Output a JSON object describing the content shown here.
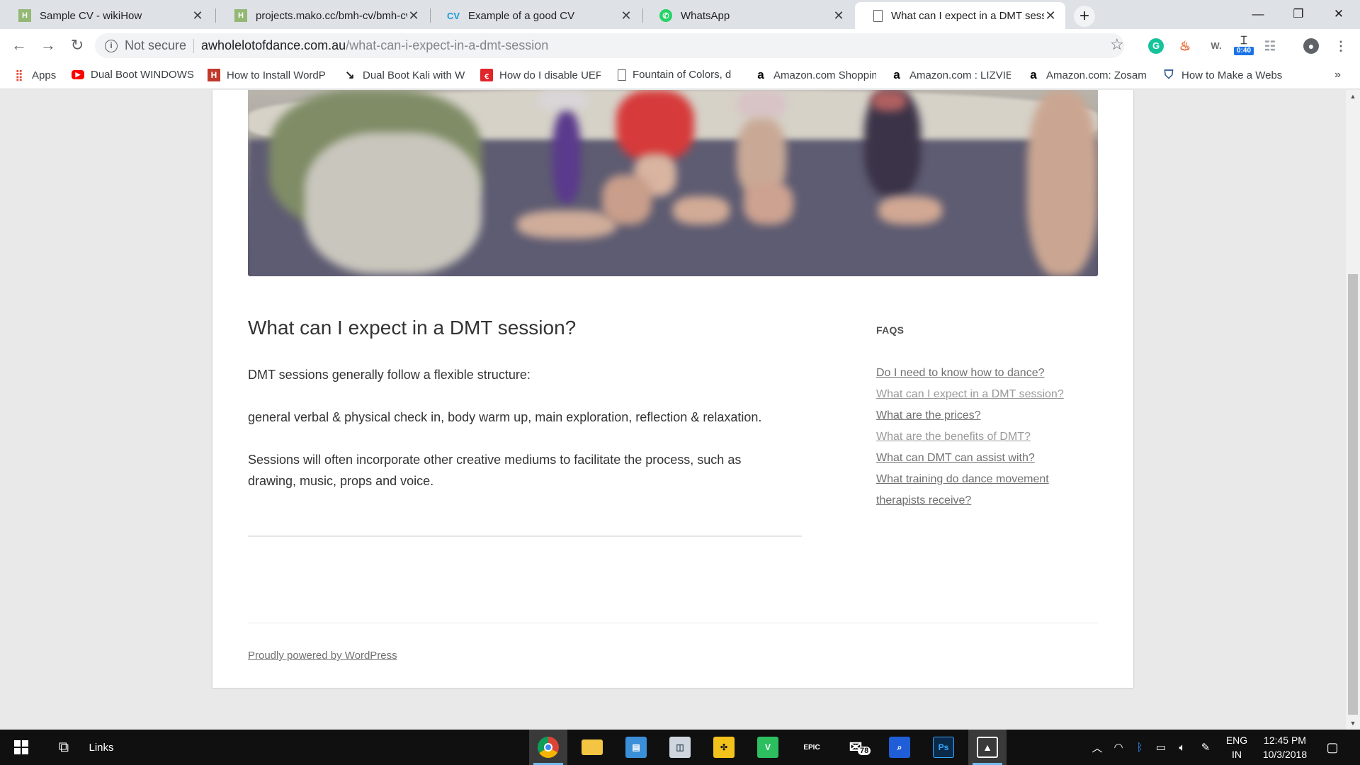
{
  "browser": {
    "tabs": [
      {
        "title": "Sample CV - wikiHow",
        "favicon": "wikihow-icon",
        "active": false
      },
      {
        "title": "projects.mako.cc/bmh-cv/bmh-cv",
        "favicon": "wikihow-icon",
        "active": false
      },
      {
        "title": "Example of a good CV",
        "favicon": "cv-icon",
        "favicon_text": "CV",
        "active": false
      },
      {
        "title": "WhatsApp",
        "favicon": "whatsapp-icon",
        "active": false
      },
      {
        "title": "What can I expect in a DMT session?",
        "favicon": "page-icon",
        "active": true
      }
    ],
    "new_tab_label": "+",
    "window_controls": {
      "minimize": "—",
      "restore": "❐",
      "close": "✕"
    },
    "address": {
      "security_label": "Not secure",
      "domain": "awholelotofdance.com.au",
      "path": "/what-can-i-expect-in-a-dmt-session"
    },
    "extensions": [
      {
        "name": "grammarly-icon",
        "text": "G",
        "color": "#15c39a"
      },
      {
        "name": "flame-extension-icon",
        "text": "🔥",
        "color": "#ffffff"
      },
      {
        "name": "wordtune-icon",
        "text": "W.",
        "color": "#ffffff"
      },
      {
        "name": "timer-extension-icon",
        "text": "0:40",
        "color": "#1a73e8"
      },
      {
        "name": "translate-extension-icon",
        "text": "T",
        "color": "#ffffff"
      },
      {
        "name": "profile-icon",
        "text": "●",
        "color": "#ffffff"
      }
    ],
    "bookmarks": [
      {
        "label": "Apps",
        "icon": "apps-grid-icon"
      },
      {
        "label": "Dual Boot WINDOWS",
        "icon": "youtube-icon"
      },
      {
        "label": "How to Install WordP",
        "icon": "wikihow-icon"
      },
      {
        "label": "Dual Boot Kali with W",
        "icon": "kali-dragon-icon"
      },
      {
        "label": "How do I disable UEF",
        "icon": "red-square-icon"
      },
      {
        "label": "Fountain of Colors, d",
        "icon": "page-icon"
      },
      {
        "label": "Amazon.com Shoppin",
        "icon": "amazon-icon"
      },
      {
        "label": "Amazon.com : LIZVIE",
        "icon": "amazon-icon"
      },
      {
        "label": "Amazon.com: Zosam",
        "icon": "amazon-icon"
      },
      {
        "label": "How to Make a Webs",
        "icon": "shield-icon"
      }
    ],
    "bookmarks_overflow": "»"
  },
  "page": {
    "title": "What can I expect in a DMT session?",
    "paragraphs": [
      "DMT sessions generally follow a flexible structure:",
      "general verbal & physical check in, body warm up, main exploration, reflection & relaxation.",
      "Sessions will often incorporate other creative mediums to facilitate the process, such as drawing, music, props and voice."
    ],
    "sidebar": {
      "heading": "FAQS",
      "links": [
        {
          "label": "Do I need to know how to dance?",
          "current": false
        },
        {
          "label": "What can I expect in a DMT session?",
          "current": true
        },
        {
          "label": "What are the prices?",
          "current": false
        },
        {
          "label": "What are the benefits of DMT?",
          "current": true
        },
        {
          "label": "What can DMT can assist with?",
          "current": false
        },
        {
          "label": "What training do dance movement therapists receive?",
          "current": false
        }
      ]
    },
    "footer_link": "Proudly powered by WordPress"
  },
  "taskbar": {
    "links_label": "Links",
    "apps": [
      {
        "name": "chrome-icon",
        "active": true,
        "color": "#ffffff",
        "text": ""
      },
      {
        "name": "file-explorer-icon",
        "active": false,
        "color": "#f4c542",
        "text": ""
      },
      {
        "name": "outlook-card-icon",
        "active": false,
        "color": "#3b8fd8",
        "text": ""
      },
      {
        "name": "drive-icon",
        "active": false,
        "color": "#cfd6df",
        "text": ""
      },
      {
        "name": "puzzle-app-icon",
        "active": false,
        "color": "#f2c21b",
        "text": ""
      },
      {
        "name": "evernote-like-icon",
        "active": false,
        "color": "#2dbe60",
        "text": "V"
      },
      {
        "name": "epic-games-icon",
        "active": false,
        "color": "#101010",
        "text": "EPIC"
      },
      {
        "name": "mail-icon",
        "active": false,
        "color": "#ffffff",
        "text": "78"
      },
      {
        "name": "search-app-icon",
        "active": false,
        "color": "#1f5ed8",
        "text": ""
      },
      {
        "name": "photoshop-icon",
        "active": false,
        "color": "#0b2a4a",
        "text": "Ps"
      },
      {
        "name": "photos-icon",
        "active": true,
        "color": "#ffffff",
        "text": ""
      }
    ],
    "tray": {
      "language_top": "ENG",
      "language_bottom": "IN",
      "time": "12:45 PM",
      "date": "10/3/2018"
    }
  }
}
